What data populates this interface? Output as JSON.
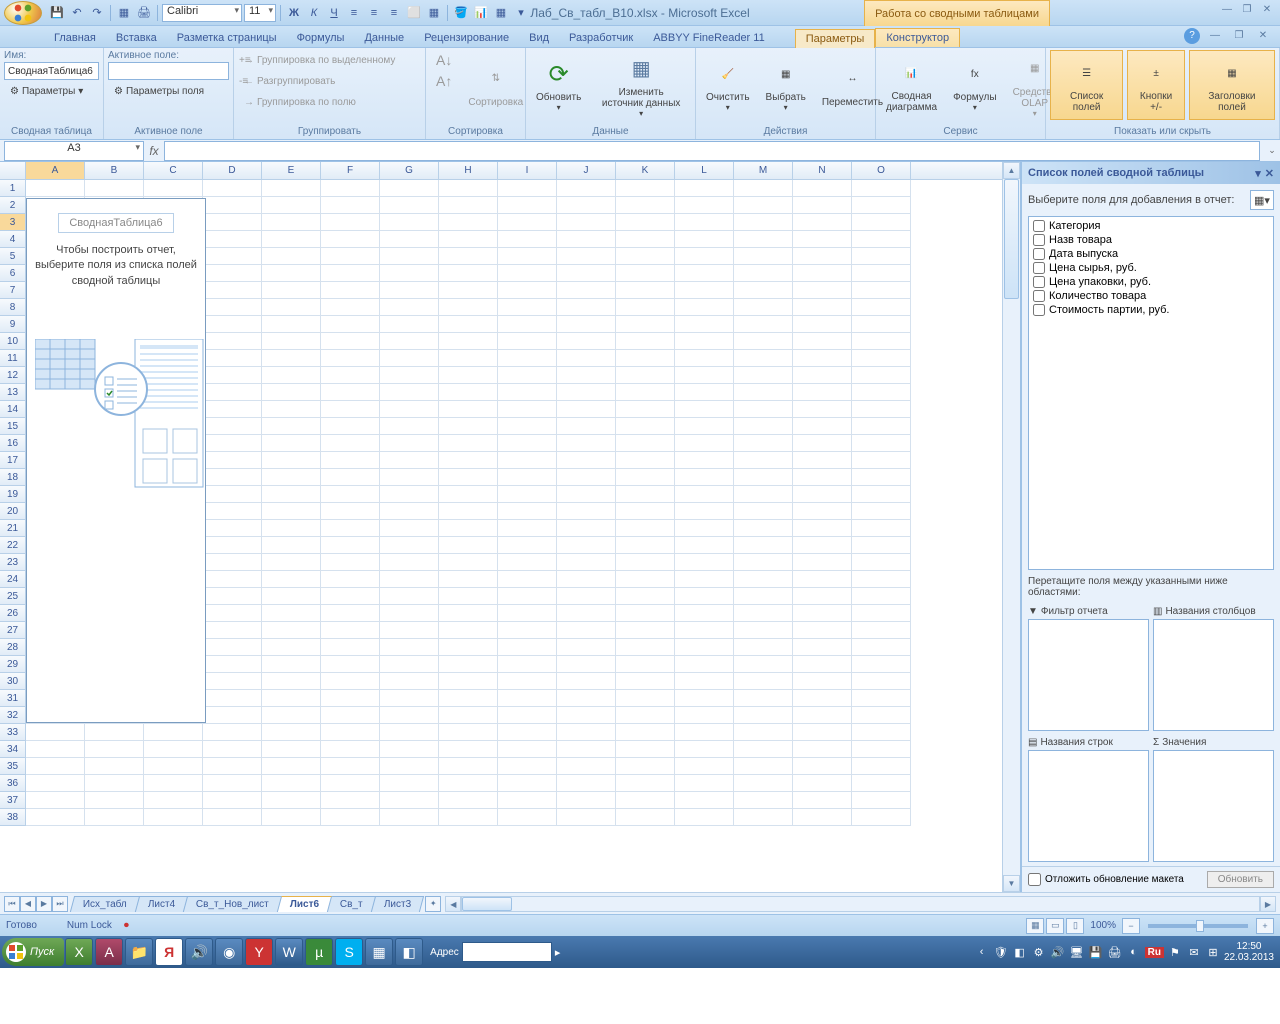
{
  "title": {
    "doc": "Лаб_Св_табл_В10.xlsx",
    "app": "Microsoft Excel"
  },
  "contextual_title": "Работа со сводными таблицами",
  "qat": {
    "font": "Calibri",
    "size": "11"
  },
  "tabs": [
    "Главная",
    "Вставка",
    "Разметка страницы",
    "Формулы",
    "Данные",
    "Рецензирование",
    "Вид",
    "Разработчик",
    "ABBYY FineReader 11"
  ],
  "ctx_tabs": [
    "Параметры",
    "Конструктор"
  ],
  "ribbon": {
    "g1": {
      "label": "Сводная таблица",
      "name_lbl": "Имя:",
      "name_val": "СводнаяТаблица6",
      "params": "Параметры"
    },
    "g2": {
      "label": "Активное поле",
      "active_lbl": "Активное поле:",
      "active_val": "",
      "params": "Параметры поля"
    },
    "g3": {
      "label": "Группировать",
      "a": "Группировка по выделенному",
      "b": "Разгруппировать",
      "c": "Группировка по полю"
    },
    "g4": {
      "label": "Сортировка",
      "btn": "Сортировка"
    },
    "g5": {
      "label": "Данные",
      "a": "Обновить",
      "b": "Изменить источник данных"
    },
    "g6": {
      "label": "Действия",
      "a": "Очистить",
      "b": "Выбрать",
      "c": "Переместить"
    },
    "g7": {
      "label": "Сервис",
      "a": "Сводная диаграмма",
      "b": "Формулы",
      "c": "Средства OLAP"
    },
    "g8": {
      "label": "Показать или скрыть",
      "a": "Список полей",
      "b": "Кнопки +/-",
      "c": "Заголовки полей"
    }
  },
  "namebox": "A3",
  "cols": [
    "A",
    "B",
    "C",
    "D",
    "E",
    "F",
    "G",
    "H",
    "I",
    "J",
    "K",
    "L",
    "M",
    "N",
    "O"
  ],
  "rows_count": 38,
  "active_cell": {
    "row": 3,
    "col": 0
  },
  "pivot": {
    "title": "СводнаяТаблица6",
    "hint": "Чтобы построить отчет, выберите поля из списка полей сводной таблицы"
  },
  "fieldlist": {
    "title": "Список полей сводной таблицы",
    "prompt": "Выберите поля для добавления в отчет:",
    "fields": [
      "Категория",
      "Назв товара",
      "Дата выпуска",
      "Цена сырья, руб.",
      "Цена упаковки, руб.",
      "Количество товара",
      "Стоимость партии, руб."
    ],
    "drag_hint": "Перетащите поля между указанными ниже областями:",
    "zones": {
      "filter": "Фильтр отчета",
      "cols": "Названия столбцов",
      "rows": "Названия строк",
      "vals": "Значения"
    },
    "defer": "Отложить обновление макета",
    "update": "Обновить"
  },
  "sheet_tabs": [
    "Исх_табл",
    "Лист4",
    "Св_т_Нов_лист",
    "Лист6",
    "Св_т",
    "Лист3"
  ],
  "active_sheet": 3,
  "status": {
    "ready": "Готово",
    "numlock": "Num Lock"
  },
  "zoom": "100%",
  "taskbar": {
    "start": "Пуск",
    "addr_label": "Адрес",
    "addr_val": "",
    "lang": "Ru",
    "time": "12:50",
    "date": "22.03.2013"
  }
}
